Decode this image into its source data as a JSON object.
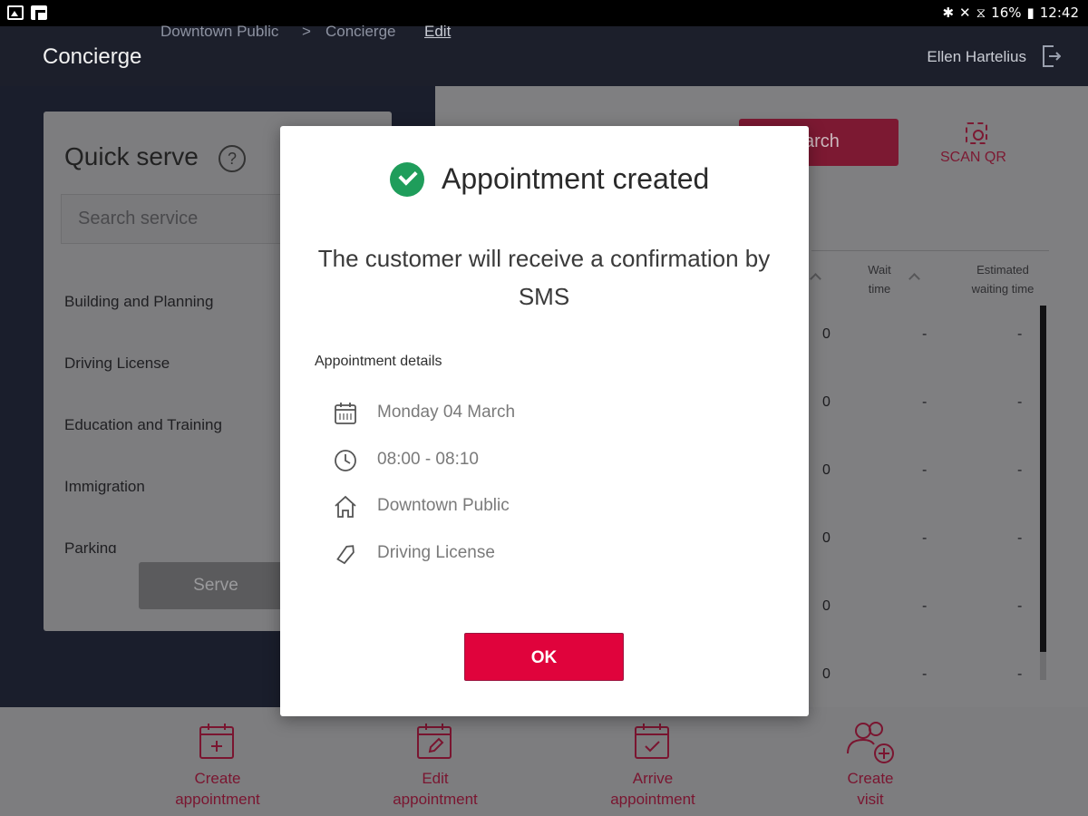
{
  "status_bar": {
    "battery": "16%",
    "time": "12:42"
  },
  "header": {
    "app_title": "Concierge",
    "breadcrumb": [
      "Downtown Public",
      "Concierge"
    ],
    "breadcrumb_separator": ">",
    "edit_label": "Edit",
    "user_name": "Ellen Hartelius"
  },
  "quick_serve": {
    "title": "Quick serve",
    "help": "?",
    "search_placeholder": "Search service",
    "services": [
      "Building and Planning",
      "Driving License",
      "Education and Training",
      "Immigration",
      "Parking"
    ],
    "serve_label": "Serve"
  },
  "right_panel": {
    "search_label": "Search",
    "search_visible": "arch",
    "scan_label": "SCAN QR",
    "columns": {
      "wait_time": "Wait time",
      "estimated": "Estimated waiting time"
    },
    "rows": [
      {
        "count": "0",
        "wait": "-",
        "estimated": "-"
      },
      {
        "count": "0",
        "wait": "-",
        "estimated": "-"
      },
      {
        "count": "0",
        "wait": "-",
        "estimated": "-"
      },
      {
        "count": "0",
        "wait": "-",
        "estimated": "-"
      },
      {
        "count": "0",
        "wait": "-",
        "estimated": "-"
      },
      {
        "count": "0",
        "wait": "-",
        "estimated": "-"
      }
    ]
  },
  "bottom_nav": [
    {
      "label_line1": "Create",
      "label_line2": "appointment",
      "icon": "calendar-plus-icon"
    },
    {
      "label_line1": "Edit",
      "label_line2": "appointment",
      "icon": "calendar-edit-icon"
    },
    {
      "label_line1": "Arrive",
      "label_line2": "appointment",
      "icon": "calendar-check-icon"
    },
    {
      "label_line1": "Create",
      "label_line2": "visit",
      "icon": "users-plus-icon"
    }
  ],
  "modal": {
    "title": "Appointment created",
    "message": "The customer will receive a confirmation by SMS",
    "details_heading": "Appointment details",
    "details": [
      {
        "icon": "calendar-icon",
        "text": "Monday 04 March"
      },
      {
        "icon": "clock-icon",
        "text": "08:00 - 08:10"
      },
      {
        "icon": "home-icon",
        "text": "Downtown Public"
      },
      {
        "icon": "tag-icon",
        "text": "Driving License"
      }
    ],
    "ok_label": "OK"
  },
  "colors": {
    "accent": "#e0033c",
    "success": "#1f9d5b",
    "header_bg": "#1c1f2b"
  }
}
